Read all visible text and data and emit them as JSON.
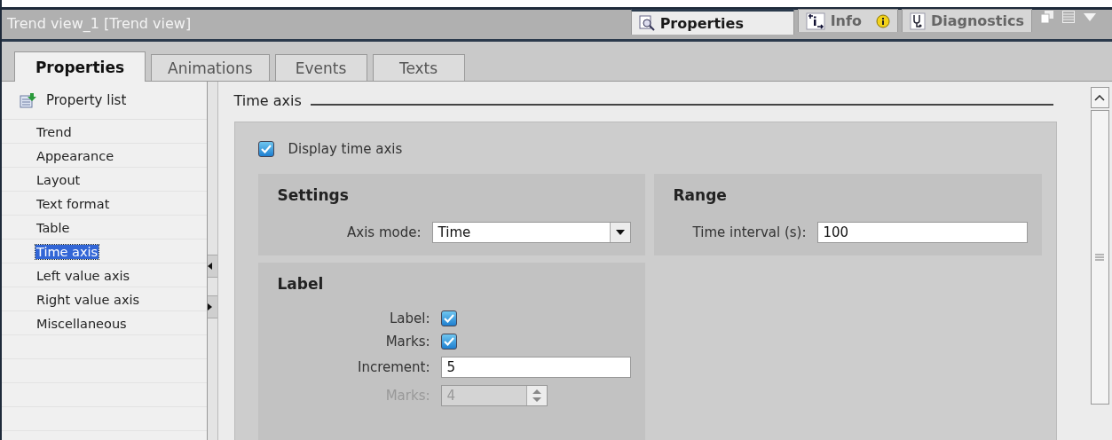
{
  "panel": {
    "title": "Trend view_1 [Trend view]"
  },
  "view_tabs": [
    {
      "kind": "properties",
      "label": "Properties",
      "selected": true
    },
    {
      "kind": "info",
      "label": "Info",
      "selected": false
    },
    {
      "kind": "diagnostics",
      "label": "Diagnostics",
      "selected": false
    }
  ],
  "tabs": [
    {
      "label": "Properties",
      "selected": true
    },
    {
      "label": "Animations",
      "selected": false
    },
    {
      "label": "Events",
      "selected": false
    },
    {
      "label": "Texts",
      "selected": false
    }
  ],
  "sidebar": {
    "header": "Property list",
    "items": [
      {
        "label": "Trend",
        "selected": false
      },
      {
        "label": "Appearance",
        "selected": false
      },
      {
        "label": "Layout",
        "selected": false
      },
      {
        "label": "Text format",
        "selected": false
      },
      {
        "label": "Table",
        "selected": false
      },
      {
        "label": "Time axis",
        "selected": true
      },
      {
        "label": "Left value axis",
        "selected": false
      },
      {
        "label": "Right value axis",
        "selected": false
      },
      {
        "label": "Miscellaneous",
        "selected": false
      }
    ]
  },
  "section": {
    "title": "Time axis",
    "display": {
      "label": "Display time axis",
      "checked": true
    }
  },
  "groups": [
    {
      "title": "Settings",
      "fields": [
        {
          "kind": "dropdown",
          "label": "Axis mode:",
          "value": "Time",
          "disabled": false
        }
      ]
    },
    {
      "title": "Range",
      "fields": [
        {
          "kind": "text",
          "label": "Time interval (s):",
          "value": "100",
          "disabled": false
        }
      ]
    },
    {
      "title": "Label",
      "fields": [
        {
          "kind": "checkbox",
          "label": "Label:",
          "checked": true,
          "disabled": false
        },
        {
          "kind": "checkbox",
          "label": "Marks:",
          "checked": true,
          "disabled": false
        },
        {
          "kind": "text",
          "label": "Increment:",
          "value": "5",
          "disabled": false
        },
        {
          "kind": "spinner",
          "label": "Marks:",
          "value": "4",
          "disabled": true
        }
      ]
    }
  ]
}
